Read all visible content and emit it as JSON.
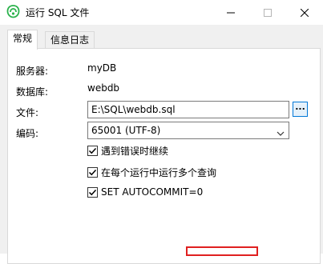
{
  "window": {
    "title": "运行 SQL 文件",
    "icon": "navicat-app-icon",
    "controls": [
      "minimize-icon",
      "maximize-icon",
      "close-icon"
    ]
  },
  "tabs": [
    {
      "label": "常规",
      "active": true
    },
    {
      "label": "信息日志",
      "active": false
    }
  ],
  "form": {
    "server_label": "服务器:",
    "server_value": "myDB",
    "database_label": "数据库:",
    "database_value": "webdb",
    "file_label": "文件:",
    "file_value": "E:\\SQL\\webdb.sql",
    "browse_label": "...",
    "encoding_label": "编码:",
    "encoding_value": "65001 (UTF-8)"
  },
  "options": [
    {
      "label": "遇到错误时继续",
      "checked": true
    },
    {
      "label": "在每个运行中运行多个查询",
      "checked": true
    },
    {
      "label": "SET AUTOCOMMIT=0",
      "checked": true
    }
  ],
  "colors": {
    "accent": "#0078d7",
    "highlight": "#e02020",
    "app_icon": "#2bb24c"
  }
}
